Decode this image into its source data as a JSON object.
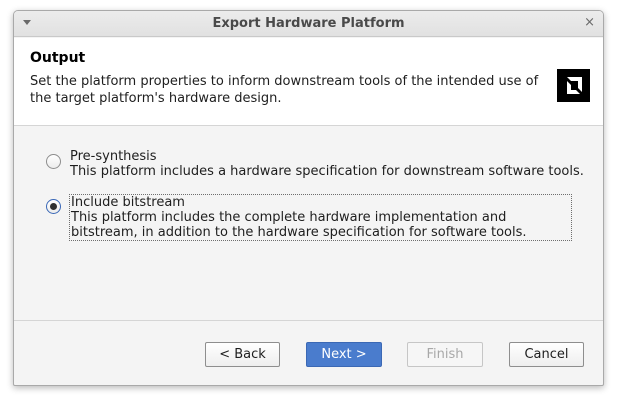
{
  "window": {
    "title": "Export Hardware Platform",
    "menu_icon": "chevron-down-icon",
    "close_glyph": "×"
  },
  "header": {
    "title": "Output",
    "description": "Set the platform properties to inform downstream tools of the intended use of the target platform's hardware design.",
    "logo_icon": "amd-logo-icon"
  },
  "options": [
    {
      "label": "Pre-synthesis",
      "description": "This platform includes a hardware specification for downstream software tools.",
      "selected": false
    },
    {
      "label": "Include bitstream",
      "description": "This platform includes the complete hardware implementation and bitstream, in addition to the hardware specification for software tools.",
      "selected": true
    }
  ],
  "buttons": {
    "back": "< Back",
    "next": "Next >",
    "finish": "Finish",
    "cancel": "Cancel"
  },
  "colors": {
    "primary_button": "#4a7ccd",
    "radio_selected_border": "#3a68b7",
    "logo": "#000000"
  }
}
